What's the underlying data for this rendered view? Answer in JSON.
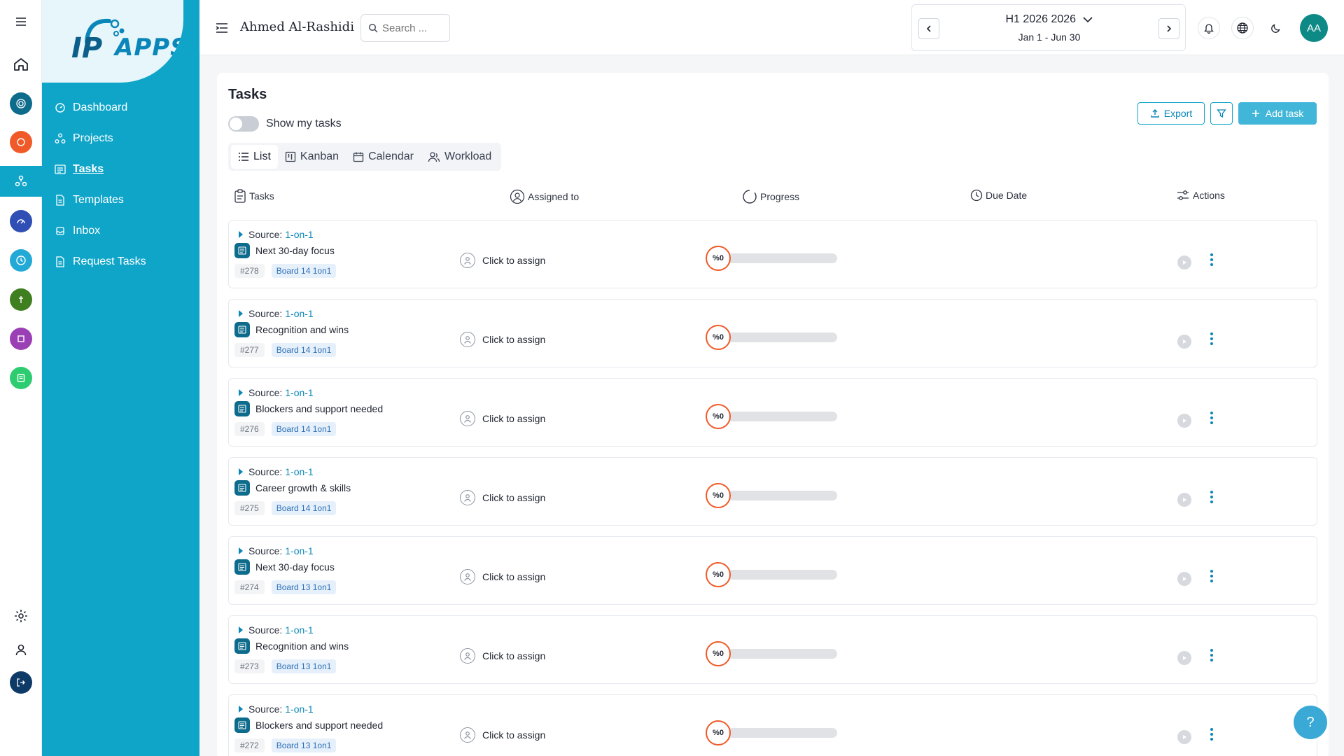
{
  "brand": {
    "logo_text": "APPS",
    "logo_prefix": "IP"
  },
  "rail": {
    "items": [
      {
        "name": "menu-icon"
      },
      {
        "name": "home-icon"
      },
      {
        "name": "target-app-icon",
        "color": "#0d6b8c"
      },
      {
        "name": "orange-app-icon",
        "color": "#f05a28"
      },
      {
        "name": "tasks-app-icon",
        "color": "#0ea5c9"
      },
      {
        "name": "gauge-app-icon",
        "color": "#2f4fb5"
      },
      {
        "name": "clock-app-icon",
        "color": "#22a9d6"
      },
      {
        "name": "green-app-icon",
        "color": "#3f7f1f"
      },
      {
        "name": "purple-app-icon",
        "color": "#9b3fb5"
      },
      {
        "name": "doc-app-icon",
        "color": "#2ecc71"
      },
      {
        "name": "settings-icon"
      },
      {
        "name": "user-icon"
      },
      {
        "name": "logout-icon",
        "color": "#0d3a66"
      }
    ]
  },
  "sidebar": {
    "items": [
      {
        "label": "Dashboard",
        "icon": "dashboard-icon"
      },
      {
        "label": "Projects",
        "icon": "projects-icon"
      },
      {
        "label": "Tasks",
        "icon": "tasks-icon",
        "active": true
      },
      {
        "label": "Templates",
        "icon": "templates-icon"
      },
      {
        "label": "Inbox",
        "icon": "inbox-icon"
      },
      {
        "label": "Request Tasks",
        "icon": "request-icon"
      }
    ]
  },
  "topbar": {
    "user_name": "Ahmed Al-Rashidi",
    "search_placeholder": "Search ...",
    "period_title": "H1 2026 2026",
    "period_range": "Jan 1 - Jun 30",
    "avatar_initials": "AA"
  },
  "page": {
    "title": "Tasks",
    "toggle_label": "Show my tasks",
    "export_label": "Export",
    "add_task_label": "Add task",
    "view_tabs": [
      "List",
      "Kanban",
      "Calendar",
      "Workload"
    ],
    "active_tab": "List",
    "columns": {
      "tasks": "Tasks",
      "assigned": "Assigned to",
      "progress": "Progress",
      "due": "Due Date",
      "actions": "Actions"
    }
  },
  "tasks": [
    {
      "source_label": "Source:",
      "source_link": "1-on-1",
      "name": "Next 30-day focus",
      "number": "#278",
      "board": "Board 14 1on1",
      "assign_label": "Click to assign",
      "progress_label": "%0",
      "progress": 0
    },
    {
      "source_label": "Source:",
      "source_link": "1-on-1",
      "name": "Recognition and wins",
      "number": "#277",
      "board": "Board 14 1on1",
      "assign_label": "Click to assign",
      "progress_label": "%0",
      "progress": 0
    },
    {
      "source_label": "Source:",
      "source_link": "1-on-1",
      "name": "Blockers and support needed",
      "number": "#276",
      "board": "Board 14 1on1",
      "assign_label": "Click to assign",
      "progress_label": "%0",
      "progress": 0
    },
    {
      "source_label": "Source:",
      "source_link": "1-on-1",
      "name": "Career growth & skills",
      "number": "#275",
      "board": "Board 14 1on1",
      "assign_label": "Click to assign",
      "progress_label": "%0",
      "progress": 0
    },
    {
      "source_label": "Source:",
      "source_link": "1-on-1",
      "name": "Next 30-day focus",
      "number": "#274",
      "board": "Board 13 1on1",
      "assign_label": "Click to assign",
      "progress_label": "%0",
      "progress": 0
    },
    {
      "source_label": "Source:",
      "source_link": "1-on-1",
      "name": "Recognition and wins",
      "number": "#273",
      "board": "Board 13 1on1",
      "assign_label": "Click to assign",
      "progress_label": "%0",
      "progress": 0
    },
    {
      "source_label": "Source:",
      "source_link": "1-on-1",
      "name": "Blockers and support needed",
      "number": "#272",
      "board": "Board 13 1on1",
      "assign_label": "Click to assign",
      "progress_label": "%0",
      "progress": 0
    }
  ],
  "help_label": "?",
  "colors": {
    "accent": "#0ea5c9",
    "link": "#0b86b8",
    "progress_ring": "#f05a28"
  }
}
